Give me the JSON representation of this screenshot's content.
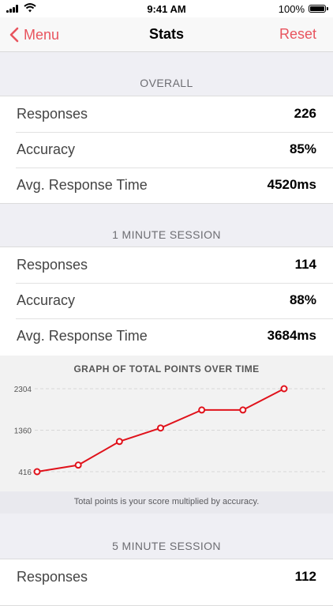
{
  "status_bar": {
    "time": "9:41 AM",
    "battery": "100%"
  },
  "nav": {
    "back_label": "Menu",
    "title": "Stats",
    "reset_label": "Reset"
  },
  "colors": {
    "accent": "#e8545e",
    "line": "#e0121b"
  },
  "overall": {
    "header": "OVERALL",
    "rows": [
      {
        "label": "Responses",
        "value": "226"
      },
      {
        "label": "Accuracy",
        "value": "85%"
      },
      {
        "label": "Avg. Response Time",
        "value": "4520ms"
      }
    ]
  },
  "one_minute": {
    "header": "1 MINUTE SESSION",
    "rows": [
      {
        "label": "Responses",
        "value": "114"
      },
      {
        "label": "Accuracy",
        "value": "88%"
      },
      {
        "label": "Avg. Response Time",
        "value": "3684ms"
      }
    ]
  },
  "graph": {
    "title": "GRAPH OF TOTAL POINTS OVER TIME",
    "footnote": "Total points is your score multiplied by accuracy."
  },
  "chart_data": {
    "type": "line",
    "title": "GRAPH OF TOTAL POINTS OVER TIME",
    "y_ticks": [
      "2304",
      "1360",
      "416"
    ],
    "ylim": [
      416,
      2304
    ],
    "x": [
      1,
      2,
      3,
      4,
      5,
      6,
      7
    ],
    "series": [
      {
        "values": [
          416,
          566,
          1103,
          1410,
          1820,
          1820,
          2304
        ]
      }
    ],
    "grid": true
  },
  "five_minute": {
    "header": "5 MINUTE SESSION",
    "rows": [
      {
        "label": "Responses",
        "value": "112"
      }
    ]
  }
}
